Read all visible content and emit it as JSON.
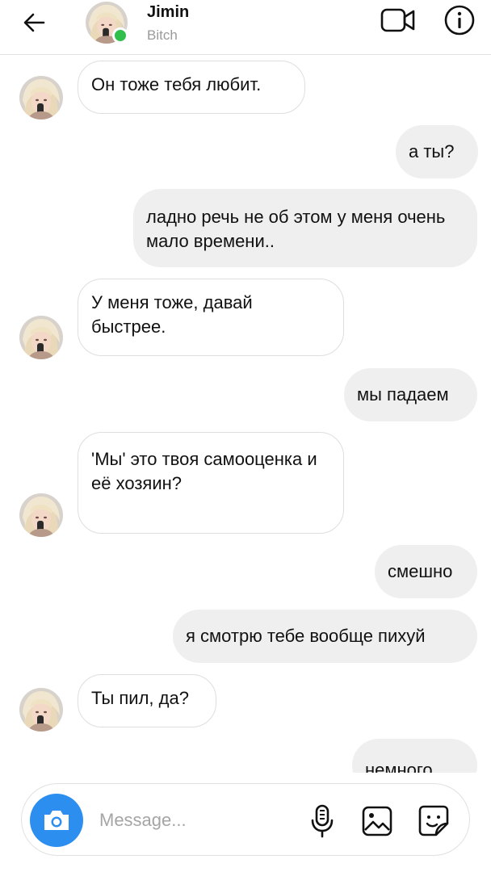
{
  "header": {
    "name": "Jimin",
    "status": "Bitch"
  },
  "messages": [
    {
      "direction": "in",
      "text": "Он тоже тебя любит."
    },
    {
      "direction": "out",
      "text": "а ты?"
    },
    {
      "direction": "out",
      "text": "ладно речь не об этом у меня очень мало времени.."
    },
    {
      "direction": "in",
      "text": "У меня тоже, давай быстрее."
    },
    {
      "direction": "out",
      "text": "мы падаем"
    },
    {
      "direction": "in",
      "text": "'Мы' это твоя самооценка и её хозяин?"
    },
    {
      "direction": "out",
      "text": "смешно"
    },
    {
      "direction": "out",
      "text": "я смотрю тебе вообще пихуй"
    },
    {
      "direction": "in",
      "text": "Ты пил, да?"
    },
    {
      "direction": "out",
      "text": "немного"
    }
  ],
  "composer": {
    "placeholder": "Message..."
  },
  "icons": {
    "back": "arrow-left-icon",
    "video": "video-camera-icon",
    "info": "info-icon",
    "camera": "camera-icon",
    "mic": "microphone-icon",
    "gallery": "image-icon",
    "sticker": "sticker-icon"
  },
  "colors": {
    "online": "#2fbf4a",
    "camera_button": "#2c8ff0",
    "outgoing_bubble": "#efeff0",
    "incoming_border": "#dedede"
  }
}
